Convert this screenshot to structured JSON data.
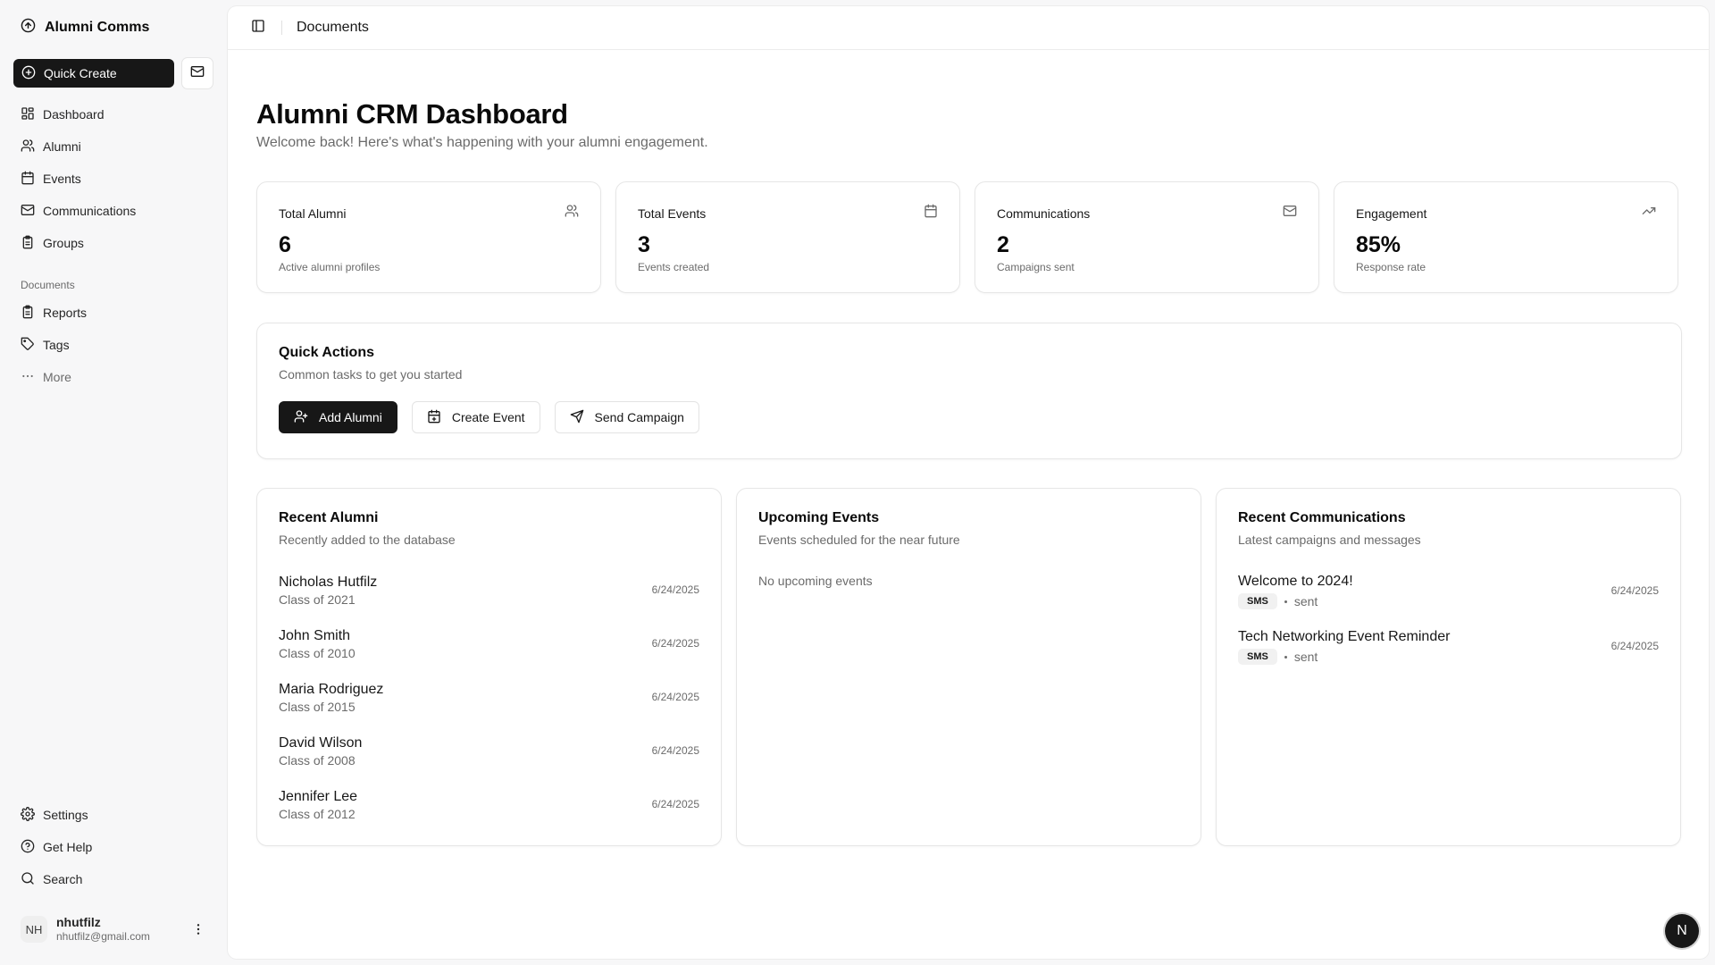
{
  "app": {
    "name": "Alumni Comms"
  },
  "sidebar": {
    "quick_create": "Quick Create",
    "main_items": [
      {
        "label": "Dashboard",
        "icon": "dashboard-icon"
      },
      {
        "label": "Alumni",
        "icon": "users-icon"
      },
      {
        "label": "Events",
        "icon": "calendar-icon"
      },
      {
        "label": "Communications",
        "icon": "mail-icon"
      },
      {
        "label": "Groups",
        "icon": "clipboard-icon"
      }
    ],
    "documents_label": "Documents",
    "doc_items": [
      {
        "label": "Reports",
        "icon": "clipboard-icon"
      },
      {
        "label": "Tags",
        "icon": "tag-icon"
      },
      {
        "label": "More",
        "icon": "more-icon"
      }
    ],
    "bottom_items": [
      {
        "label": "Settings",
        "icon": "gear-icon"
      },
      {
        "label": "Get Help",
        "icon": "help-icon"
      },
      {
        "label": "Search",
        "icon": "search-icon"
      }
    ],
    "user": {
      "initials": "NH",
      "name": "nhutfilz",
      "email": "nhutfilz@gmail.com"
    }
  },
  "header": {
    "breadcrumb": "Documents"
  },
  "page": {
    "title": "Alumni CRM Dashboard",
    "subtitle": "Welcome back! Here's what's happening with your alumni engagement."
  },
  "stats": [
    {
      "title": "Total Alumni",
      "value": "6",
      "note": "Active alumni profiles",
      "icon": "users-icon"
    },
    {
      "title": "Total Events",
      "value": "3",
      "note": "Events created",
      "icon": "calendar-icon"
    },
    {
      "title": "Communications",
      "value": "2",
      "note": "Campaigns sent",
      "icon": "mail-icon"
    },
    {
      "title": "Engagement",
      "value": "85%",
      "note": "Response rate",
      "icon": "trending-up-icon"
    }
  ],
  "quick_actions": {
    "title": "Quick Actions",
    "desc": "Common tasks to get you started",
    "buttons": [
      {
        "label": "Add Alumni",
        "icon": "user-plus-icon"
      },
      {
        "label": "Create Event",
        "icon": "calendar-plus-icon"
      },
      {
        "label": "Send Campaign",
        "icon": "send-icon"
      }
    ]
  },
  "recent_alumni": {
    "title": "Recent Alumni",
    "desc": "Recently added to the database",
    "items": [
      {
        "name": "Nicholas Hutfilz",
        "class": "Class of 2021",
        "date": "6/24/2025"
      },
      {
        "name": "John Smith",
        "class": "Class of 2010",
        "date": "6/24/2025"
      },
      {
        "name": "Maria Rodriguez",
        "class": "Class of 2015",
        "date": "6/24/2025"
      },
      {
        "name": "David Wilson",
        "class": "Class of 2008",
        "date": "6/24/2025"
      },
      {
        "name": "Jennifer Lee",
        "class": "Class of 2012",
        "date": "6/24/2025"
      }
    ]
  },
  "upcoming_events": {
    "title": "Upcoming Events",
    "desc": "Events scheduled for the near future",
    "empty": "No upcoming events"
  },
  "recent_comms": {
    "title": "Recent Communications",
    "desc": "Latest campaigns and messages",
    "items": [
      {
        "title": "Welcome to 2024!",
        "channel": "SMS",
        "status": "sent",
        "date": "6/24/2025"
      },
      {
        "title": "Tech Networking Event Reminder",
        "channel": "SMS",
        "status": "sent",
        "date": "6/24/2025"
      }
    ]
  },
  "fab": {
    "label": "N"
  },
  "colors": {
    "primary": "#171717",
    "muted_text": "#6b6b6b",
    "border": "#e6e6e6",
    "background": "#f7f7f8"
  }
}
